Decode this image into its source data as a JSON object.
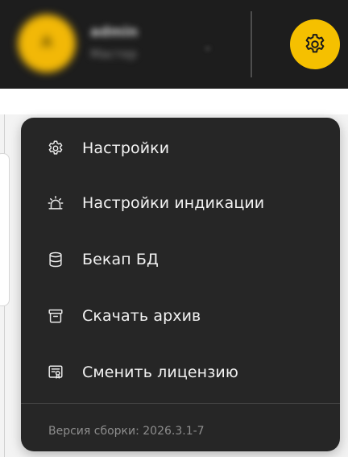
{
  "header": {
    "avatar_letter": "A",
    "user_name": "admin",
    "user_role": "Мастер",
    "chevron": "⌄",
    "settings_icon": "gear-icon",
    "accent_color": "#f5c000"
  },
  "menu": {
    "items": [
      {
        "label": "Настройки",
        "icon": "gear-icon"
      },
      {
        "label": "Настройки индикации",
        "icon": "alarm-light-icon"
      },
      {
        "label": "Бекап БД",
        "icon": "database-icon"
      },
      {
        "label": "Скачать архив",
        "icon": "archive-icon"
      },
      {
        "label": "Сменить лицензию",
        "icon": "license-icon"
      }
    ],
    "version": "Версия сборки: 2026.3.1-7"
  },
  "colors": {
    "header_bg": "#1d1d1d",
    "menu_bg": "#262626",
    "menu_text": "#f2f2f2",
    "version_text": "#8e8e8e"
  }
}
